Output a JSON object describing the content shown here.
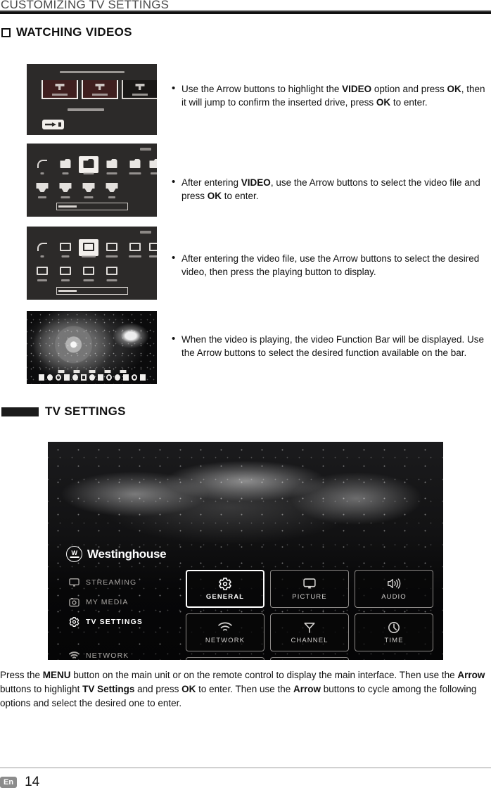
{
  "running_head": "CUSTOMIZING TV SETTINGS",
  "sections": [
    {
      "id": "watching-videos",
      "title": "WATCHING VIDEOS",
      "marker": "square-outline-marker"
    },
    {
      "id": "tv-settings",
      "title": "TV SETTINGS",
      "marker": "solid-block-marker"
    }
  ],
  "steps": [
    {
      "screenshot_name": "usb-source-select-screen",
      "text_parts": [
        {
          "t": "Use the Arrow buttons to highlight the ",
          "b": false
        },
        {
          "t": "VIDEO",
          "b": true
        },
        {
          "t": " option and press ",
          "b": false
        },
        {
          "t": "OK",
          "b": true
        },
        {
          "t": ", then it will jump to confirm the inserted drive, press ",
          "b": false
        },
        {
          "t": "OK",
          "b": true
        },
        {
          "t": " to enter.",
          "b": false
        }
      ],
      "text_plain": "Use the Arrow buttons to highlight the VIDEO option and press OK, then it will jump to confirm the inserted drive, press OK to enter."
    },
    {
      "screenshot_name": "video-folder-browser-screen",
      "text_parts": [
        {
          "t": "After entering ",
          "b": false
        },
        {
          "t": "VIDEO",
          "b": true
        },
        {
          "t": ", use the Arrow buttons to select the video file and press ",
          "b": false
        },
        {
          "t": "OK",
          "b": true
        },
        {
          "t": " to enter.",
          "b": false
        }
      ],
      "text_plain": "After entering VIDEO, use the Arrow buttons to select the video file and press OK to enter."
    },
    {
      "screenshot_name": "video-file-list-screen",
      "text_parts": [
        {
          "t": "After entering the video file, use the Arrow buttons to select the desired video, then press the playing button to display.",
          "b": false
        }
      ],
      "text_plain": "After entering the video file, use the Arrow buttons to select the desired video, then press the playing button to display."
    },
    {
      "screenshot_name": "video-playback-function-bar-screen",
      "text_parts": [
        {
          "t": "When the video is playing, the video Function Bar will be displayed. Use the Arrow buttons to select the desired function available on the bar.",
          "b": false
        }
      ],
      "text_plain": "When the video is playing, the video Function Bar will be displayed. Use the Arrow buttons to select the desired function available on the bar."
    }
  ],
  "tv_ui": {
    "brand": "Westinghouse",
    "nav": [
      {
        "label": "STREAMING",
        "icon": "monitor-icon",
        "active": false
      },
      {
        "label": "MY MEDIA",
        "icon": "camera-icon",
        "active": false
      },
      {
        "label": "TV SETTINGS",
        "icon": "gear-icon",
        "active": true
      },
      {
        "label": "NETWORK",
        "icon": "wifi-icon",
        "active": false
      }
    ],
    "tiles": [
      {
        "label": "GENERAL",
        "icon": "gear-icon",
        "selected": true
      },
      {
        "label": "PICTURE",
        "icon": "monitor-icon",
        "selected": false
      },
      {
        "label": "AUDIO",
        "icon": "speaker-icon",
        "selected": false
      },
      {
        "label": "NETWORK",
        "icon": "wifi-icon",
        "selected": false
      },
      {
        "label": "CHANNEL",
        "icon": "antenna-icon",
        "selected": false
      },
      {
        "label": "TIME",
        "icon": "clock-icon",
        "selected": false
      },
      {
        "label": "",
        "icon": "lock-icon",
        "selected": false
      },
      {
        "label": "",
        "icon": "play-circle-icon",
        "selected": false
      }
    ]
  },
  "body_paragraph_parts": [
    {
      "t": "Press the ",
      "b": false
    },
    {
      "t": "MENU",
      "b": true
    },
    {
      "t": " button on the main unit or on the remote control to display the main interface. Then use the ",
      "b": false
    },
    {
      "t": "Arrow",
      "b": true
    },
    {
      "t": " buttons to highlight ",
      "b": false
    },
    {
      "t": "TV Settings",
      "b": true
    },
    {
      "t": " and press ",
      "b": false
    },
    {
      "t": "OK",
      "b": true
    },
    {
      "t": " to enter. Then use the ",
      "b": false
    },
    {
      "t": "Arrow",
      "b": true
    },
    {
      "t": " buttons to cycle among the following options and select the desired one to enter.",
      "b": false
    }
  ],
  "body_paragraph_plain": "Press the MENU button on the main unit or on the remote control to display the main interface. Then use the Arrow buttons to highlight TV Settings and press OK to enter. Then use the Arrow buttons to cycle among the following options and select the desired one to enter.",
  "footer": {
    "language": "En",
    "page_number": "14"
  }
}
